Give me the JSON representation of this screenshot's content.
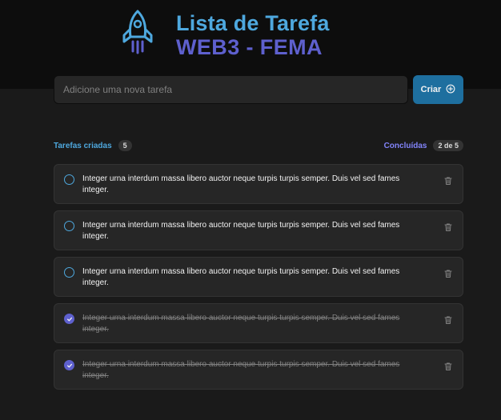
{
  "header": {
    "title_line1": "Lista de Tarefa",
    "title_line2": "WEB3 - FEMA",
    "logo_icon": "rocket-icon"
  },
  "new_task": {
    "placeholder": "Adicione uma nova tarefa",
    "value": "",
    "create_label": "Criar",
    "create_icon": "plus-circle-icon"
  },
  "counters": {
    "created_label": "Tarefas criadas",
    "created_count": "5",
    "done_label": "Concluídas",
    "done_count": "2 de 5"
  },
  "tasks": [
    {
      "text": "Integer urna interdum massa libero auctor neque turpis turpis semper. Duis vel sed fames integer.",
      "completed": false
    },
    {
      "text": "Integer urna interdum massa libero auctor neque turpis turpis semper. Duis vel sed fames integer.",
      "completed": false
    },
    {
      "text": "Integer urna interdum massa libero auctor neque turpis turpis semper. Duis vel sed fames integer.",
      "completed": false
    },
    {
      "text": "Integer urna interdum massa libero auctor neque turpis turpis semper. Duis vel sed fames integer.",
      "completed": true
    },
    {
      "text": "Integer urna interdum massa libero auctor neque turpis turpis semper. Duis vel sed fames integer.",
      "completed": true
    }
  ],
  "colors": {
    "blue": "#4ea8de",
    "purple": "#5e60ce",
    "button": "#1e6f9f",
    "background": "#1a1a1a",
    "header": "#0d0d0d",
    "card": "#262626"
  }
}
